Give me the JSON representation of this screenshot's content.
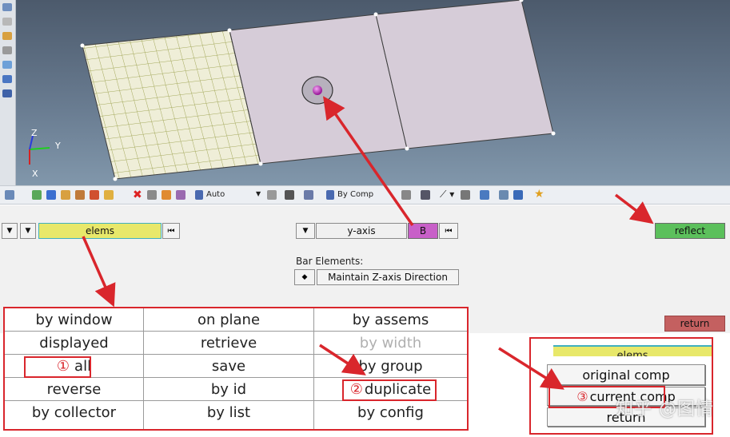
{
  "viewport": {
    "axis_z": "Z",
    "axis_y": "Y",
    "axis_x": "X"
  },
  "toolbar": {
    "auto_label": "Auto",
    "by_comp_label": "By Comp"
  },
  "panel": {
    "elems_label": "elems",
    "yaxis_label": "y-axis",
    "b_label": "B",
    "reflect_label": "reflect",
    "bar_elements_label": "Bar Elements:",
    "bar_direction_value": "Maintain Z-axis Direction",
    "return_label": "return"
  },
  "menu": {
    "col1": [
      "by window",
      "displayed",
      "all",
      "reverse",
      "by collector"
    ],
    "col2": [
      "on plane",
      "retrieve",
      "save",
      "by id",
      "by list"
    ],
    "col3": [
      "by assems",
      "by width",
      "by group",
      "duplicate",
      "by config"
    ],
    "step1": "①",
    "step2": "②"
  },
  "popup": {
    "elems_label": "elems",
    "original_comp": "original comp",
    "current_comp": "current comp",
    "return_label": "return",
    "step3": "③"
  },
  "watermark": "知乎 @图情",
  "colors": {
    "elems_field": "#e8e86a",
    "b_field": "#c860c8",
    "reflect_button": "#5cc05c",
    "return_button": "#c46060",
    "annotation_red": "#d9262c"
  }
}
